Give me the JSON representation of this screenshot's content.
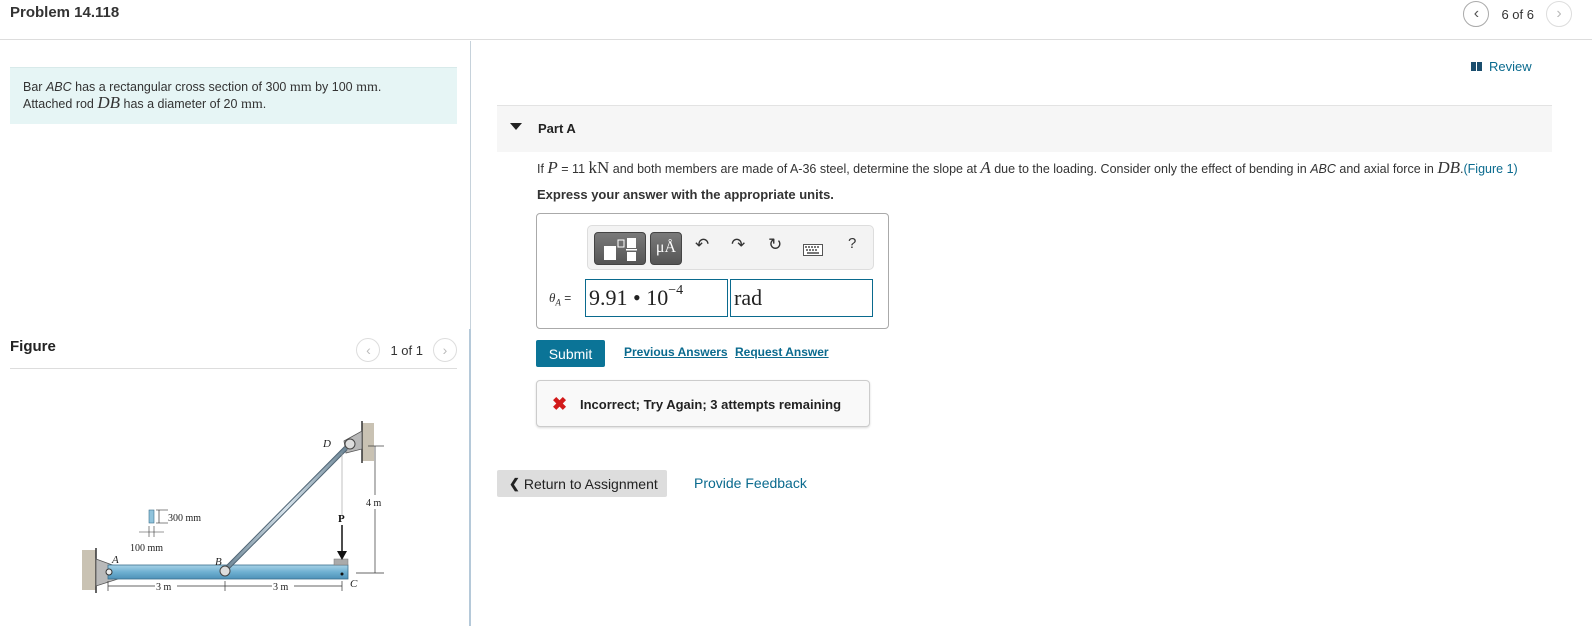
{
  "header": {
    "problem_title": "Problem 14.118",
    "pager": {
      "text": "6 of 6",
      "prev_icon": "chevron-left-icon",
      "next_icon": "chevron-right-icon"
    }
  },
  "intro": {
    "line1_pre": "Bar ",
    "line1_abc": "ABC",
    "line1_mid": " has a rectangular cross section of 300 ",
    "line1_mm1": "mm",
    "line1_by": " by 100 ",
    "line1_mm2": "mm",
    "line1_end": ".",
    "line2_pre": "Attached rod ",
    "line2_db": "DB",
    "line2_mid": " has a diameter of 20 ",
    "line2_mm": "mm",
    "line2_end": "."
  },
  "figure": {
    "title": "Figure",
    "pager": "1 of 1",
    "labels": {
      "A": "A",
      "B": "B",
      "C": "C",
      "D": "D",
      "P": "P",
      "height_dim": "4 m",
      "span_ab": "3 m",
      "span_bc": "3 m",
      "section_h": "300 mm",
      "section_w": "100 mm"
    }
  },
  "review": {
    "label": "Review",
    "icon": "book-icon"
  },
  "part": {
    "title": "Part A",
    "question": {
      "q1": "If ",
      "p_sym": "P",
      "q2": " = 11 ",
      "kn": "kN",
      "q3": " and both members are made of A-36 steel, determine the slope at ",
      "a_sym": "A",
      "q4": " due to the loading. Consider only the effect of bending in ",
      "abc": "ABC",
      "q5": " and axial force in ",
      "db": "DB",
      "q6": ".",
      "figure_link": "(Figure 1)"
    },
    "instruction": "Express your answer with the appropriate units.",
    "toolbar": {
      "buttons": [
        "templates-icon",
        "units-icon",
        "undo-icon",
        "redo-icon",
        "reset-icon",
        "keyboard-icon",
        "help-icon"
      ],
      "units_label": "μÅ",
      "help_label": "?"
    },
    "answer": {
      "label_sym": "θ",
      "label_sub": "A",
      "label_eq": " =",
      "value_mantissa": "9.91 • 10",
      "value_exponent": "−4",
      "unit": "rad"
    },
    "submit_label": "Submit",
    "previous_answers_label": "Previous Answers",
    "request_answer_label": "Request Answer",
    "feedback": {
      "icon": "x-icon",
      "text": "Incorrect; Try Again; 3 attempts remaining"
    }
  },
  "footer": {
    "return_label": "Return to Assignment",
    "provide_feedback_label": "Provide Feedback"
  }
}
